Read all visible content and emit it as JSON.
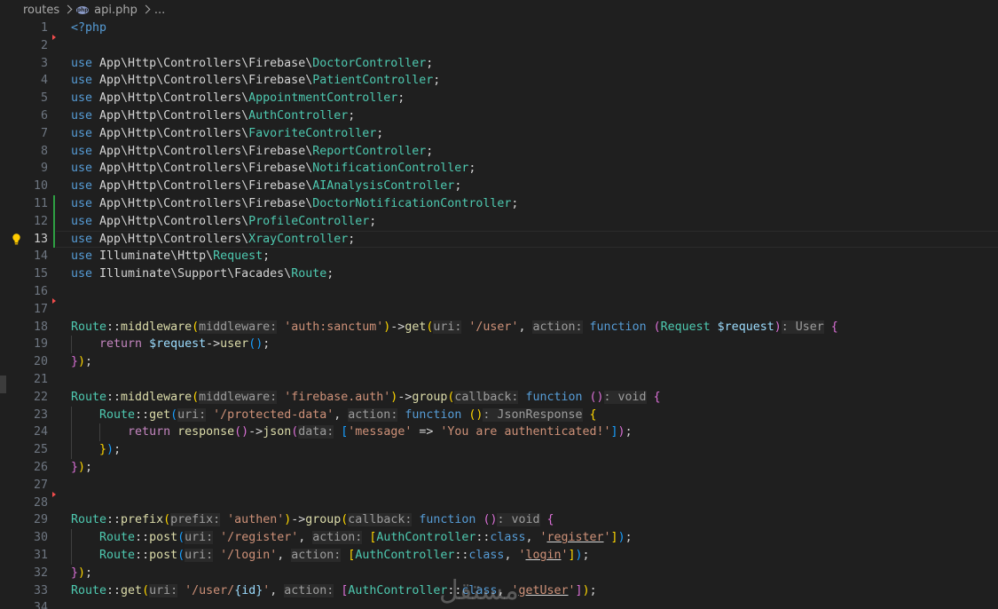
{
  "breadcrumb": {
    "folder": "routes",
    "file": "api.php",
    "file_icon": "php-file-icon",
    "more": "..."
  },
  "watermark": "مستقل",
  "current_line": 13,
  "lines": [
    {
      "n": "1",
      "tokens": [
        [
          "<?php",
          "tag"
        ]
      ]
    },
    {
      "n": "2",
      "tokens": [],
      "marker": "deleted"
    },
    {
      "n": "3",
      "tokens": [
        [
          "use",
          "kw"
        ],
        [
          " App\\Http\\Controllers\\Firebase\\",
          "plain"
        ],
        [
          "DoctorController",
          "cls"
        ],
        [
          ";",
          "plain"
        ]
      ]
    },
    {
      "n": "4",
      "tokens": [
        [
          "use",
          "kw"
        ],
        [
          " App\\Http\\Controllers\\Firebase\\",
          "plain"
        ],
        [
          "PatientController",
          "cls"
        ],
        [
          ";",
          "plain"
        ]
      ]
    },
    {
      "n": "5",
      "tokens": [
        [
          "use",
          "kw"
        ],
        [
          " App\\Http\\Controllers\\",
          "plain"
        ],
        [
          "AppointmentController",
          "cls"
        ],
        [
          ";",
          "plain"
        ]
      ]
    },
    {
      "n": "6",
      "tokens": [
        [
          "use",
          "kw"
        ],
        [
          " App\\Http\\Controllers\\",
          "plain"
        ],
        [
          "AuthController",
          "cls"
        ],
        [
          ";",
          "plain"
        ]
      ]
    },
    {
      "n": "7",
      "tokens": [
        [
          "use",
          "kw"
        ],
        [
          " App\\Http\\Controllers\\",
          "plain"
        ],
        [
          "FavoriteController",
          "cls"
        ],
        [
          ";",
          "plain"
        ]
      ]
    },
    {
      "n": "8",
      "tokens": [
        [
          "use",
          "kw"
        ],
        [
          " App\\Http\\Controllers\\Firebase\\",
          "plain"
        ],
        [
          "ReportController",
          "cls"
        ],
        [
          ";",
          "plain"
        ]
      ]
    },
    {
      "n": "9",
      "tokens": [
        [
          "use",
          "kw"
        ],
        [
          " App\\Http\\Controllers\\Firebase\\",
          "plain"
        ],
        [
          "NotificationController",
          "cls"
        ],
        [
          ";",
          "plain"
        ]
      ]
    },
    {
      "n": "10",
      "tokens": [
        [
          "use",
          "kw"
        ],
        [
          " App\\Http\\Controllers\\Firebase\\",
          "plain"
        ],
        [
          "AIAnalysisController",
          "cls"
        ],
        [
          ";",
          "plain"
        ]
      ]
    },
    {
      "n": "11",
      "tokens": [
        [
          "use",
          "kw"
        ],
        [
          " App\\Http\\Controllers\\Firebase\\",
          "plain"
        ],
        [
          "DoctorNotificationController",
          "cls"
        ],
        [
          ";",
          "plain"
        ]
      ],
      "marker": "added"
    },
    {
      "n": "12",
      "tokens": [
        [
          "use",
          "kw"
        ],
        [
          " App\\Http\\Controllers\\",
          "plain"
        ],
        [
          "ProfileController",
          "cls"
        ],
        [
          ";",
          "plain"
        ]
      ],
      "marker": "added"
    },
    {
      "n": "13",
      "tokens": [
        [
          "use",
          "kw"
        ],
        [
          " App\\Http\\Controllers\\",
          "plain"
        ],
        [
          "XrayController",
          "cls"
        ],
        [
          ";",
          "plain"
        ]
      ],
      "marker": "added",
      "lightbulb": true
    },
    {
      "n": "14",
      "tokens": [
        [
          "use",
          "kw"
        ],
        [
          " Illuminate\\Http\\",
          "plain"
        ],
        [
          "Request",
          "cls"
        ],
        [
          ";",
          "plain"
        ]
      ]
    },
    {
      "n": "15",
      "tokens": [
        [
          "use",
          "kw"
        ],
        [
          " Illuminate\\Support\\Facades\\",
          "plain"
        ],
        [
          "Route",
          "cls"
        ],
        [
          ";",
          "plain"
        ]
      ]
    },
    {
      "n": "16",
      "tokens": []
    },
    {
      "n": "17",
      "tokens": [],
      "marker": "deleted"
    },
    {
      "n": "18",
      "tokens": [
        [
          "Route",
          "cls"
        ],
        [
          "::",
          "plain"
        ],
        [
          "middleware",
          "fn"
        ],
        [
          "(",
          "p1"
        ],
        [
          "middleware:",
          "hint"
        ],
        [
          " ",
          "plain"
        ],
        [
          "'auth:sanctum'",
          "str"
        ],
        [
          ")",
          "p1"
        ],
        [
          "->",
          "plain"
        ],
        [
          "get",
          "fn"
        ],
        [
          "(",
          "p1"
        ],
        [
          "uri:",
          "hint"
        ],
        [
          " ",
          "plain"
        ],
        [
          "'/user'",
          "str"
        ],
        [
          ", ",
          "plain"
        ],
        [
          "action:",
          "hint"
        ],
        [
          " ",
          "plain"
        ],
        [
          "function",
          "kw"
        ],
        [
          " ",
          "plain"
        ],
        [
          "(",
          "p2"
        ],
        [
          "Request",
          "cls"
        ],
        [
          " ",
          "plain"
        ],
        [
          "$request",
          "var"
        ],
        [
          ")",
          "p2"
        ],
        [
          ": User",
          "hint"
        ],
        [
          " ",
          "plain"
        ],
        [
          "{",
          "p2"
        ]
      ]
    },
    {
      "n": "19",
      "tokens": [
        [
          "    ",
          "plain"
        ],
        [
          "return",
          "ctrl"
        ],
        [
          " ",
          "plain"
        ],
        [
          "$request",
          "var"
        ],
        [
          "->",
          "plain"
        ],
        [
          "user",
          "fn"
        ],
        [
          "()",
          "p3"
        ],
        [
          ";",
          "plain"
        ]
      ],
      "guides": [
        1
      ]
    },
    {
      "n": "20",
      "tokens": [
        [
          "}",
          "p2"
        ],
        [
          ")",
          "p1"
        ],
        [
          ";",
          "plain"
        ]
      ]
    },
    {
      "n": "21",
      "tokens": []
    },
    {
      "n": "22",
      "tokens": [
        [
          "Route",
          "cls"
        ],
        [
          "::",
          "plain"
        ],
        [
          "middleware",
          "fn"
        ],
        [
          "(",
          "p1"
        ],
        [
          "middleware:",
          "hint"
        ],
        [
          " ",
          "plain"
        ],
        [
          "'firebase.auth'",
          "str"
        ],
        [
          ")",
          "p1"
        ],
        [
          "->",
          "plain"
        ],
        [
          "group",
          "fn"
        ],
        [
          "(",
          "p1"
        ],
        [
          "callback:",
          "hint"
        ],
        [
          " ",
          "plain"
        ],
        [
          "function",
          "kw"
        ],
        [
          " ",
          "plain"
        ],
        [
          "()",
          "p2"
        ],
        [
          ": void",
          "hint"
        ],
        [
          " ",
          "plain"
        ],
        [
          "{",
          "p2"
        ]
      ]
    },
    {
      "n": "23",
      "tokens": [
        [
          "    ",
          "plain"
        ],
        [
          "Route",
          "cls"
        ],
        [
          "::",
          "plain"
        ],
        [
          "get",
          "fn"
        ],
        [
          "(",
          "p3"
        ],
        [
          "uri:",
          "hint"
        ],
        [
          " ",
          "plain"
        ],
        [
          "'/protected-data'",
          "str"
        ],
        [
          ", ",
          "plain"
        ],
        [
          "action:",
          "hint"
        ],
        [
          " ",
          "plain"
        ],
        [
          "function",
          "kw"
        ],
        [
          " ",
          "plain"
        ],
        [
          "()",
          "p1"
        ],
        [
          ": JsonResponse",
          "hint"
        ],
        [
          " ",
          "plain"
        ],
        [
          "{",
          "p1"
        ]
      ],
      "guides": [
        1
      ]
    },
    {
      "n": "24",
      "tokens": [
        [
          "        ",
          "plain"
        ],
        [
          "return",
          "ctrl"
        ],
        [
          " ",
          "plain"
        ],
        [
          "response",
          "fn"
        ],
        [
          "()",
          "p2"
        ],
        [
          "->",
          "plain"
        ],
        [
          "json",
          "fn"
        ],
        [
          "(",
          "p2"
        ],
        [
          "data:",
          "hint"
        ],
        [
          " ",
          "plain"
        ],
        [
          "[",
          "p3"
        ],
        [
          "'message'",
          "str"
        ],
        [
          " => ",
          "plain"
        ],
        [
          "'You are authenticated!'",
          "str"
        ],
        [
          "]",
          "p3"
        ],
        [
          ")",
          "p2"
        ],
        [
          ";",
          "plain"
        ]
      ],
      "guides": [
        1,
        2
      ]
    },
    {
      "n": "25",
      "tokens": [
        [
          "    ",
          "plain"
        ],
        [
          "}",
          "p1"
        ],
        [
          ")",
          "p3"
        ],
        [
          ";",
          "plain"
        ]
      ],
      "guides": [
        1
      ]
    },
    {
      "n": "26",
      "tokens": [
        [
          "}",
          "p2"
        ],
        [
          ")",
          "p1"
        ],
        [
          ";",
          "plain"
        ]
      ]
    },
    {
      "n": "27",
      "tokens": []
    },
    {
      "n": "28",
      "tokens": [],
      "marker": "deleted"
    },
    {
      "n": "29",
      "tokens": [
        [
          "Route",
          "cls"
        ],
        [
          "::",
          "plain"
        ],
        [
          "prefix",
          "fn"
        ],
        [
          "(",
          "p1"
        ],
        [
          "prefix:",
          "hint"
        ],
        [
          " ",
          "plain"
        ],
        [
          "'authen'",
          "str"
        ],
        [
          ")",
          "p1"
        ],
        [
          "->",
          "plain"
        ],
        [
          "group",
          "fn"
        ],
        [
          "(",
          "p1"
        ],
        [
          "callback:",
          "hint"
        ],
        [
          " ",
          "plain"
        ],
        [
          "function",
          "kw"
        ],
        [
          " ",
          "plain"
        ],
        [
          "()",
          "p2"
        ],
        [
          ": void",
          "hint"
        ],
        [
          " ",
          "plain"
        ],
        [
          "{",
          "p2"
        ]
      ]
    },
    {
      "n": "30",
      "tokens": [
        [
          "    ",
          "plain"
        ],
        [
          "Route",
          "cls"
        ],
        [
          "::",
          "plain"
        ],
        [
          "post",
          "fn"
        ],
        [
          "(",
          "p3"
        ],
        [
          "uri:",
          "hint"
        ],
        [
          " ",
          "plain"
        ],
        [
          "'/register'",
          "str"
        ],
        [
          ", ",
          "plain"
        ],
        [
          "action:",
          "hint"
        ],
        [
          " ",
          "plain"
        ],
        [
          "[",
          "p1"
        ],
        [
          "AuthController",
          "cls"
        ],
        [
          "::",
          "plain"
        ],
        [
          "class",
          "kw"
        ],
        [
          ", ",
          "plain"
        ],
        [
          "'",
          "str"
        ],
        [
          "register",
          "strul"
        ],
        [
          "'",
          "str"
        ],
        [
          "]",
          "p1"
        ],
        [
          ")",
          "p3"
        ],
        [
          ";",
          "plain"
        ]
      ],
      "guides": [
        1
      ]
    },
    {
      "n": "31",
      "tokens": [
        [
          "    ",
          "plain"
        ],
        [
          "Route",
          "cls"
        ],
        [
          "::",
          "plain"
        ],
        [
          "post",
          "fn"
        ],
        [
          "(",
          "p3"
        ],
        [
          "uri:",
          "hint"
        ],
        [
          " ",
          "plain"
        ],
        [
          "'/login'",
          "str"
        ],
        [
          ", ",
          "plain"
        ],
        [
          "action:",
          "hint"
        ],
        [
          " ",
          "plain"
        ],
        [
          "[",
          "p1"
        ],
        [
          "AuthController",
          "cls"
        ],
        [
          "::",
          "plain"
        ],
        [
          "class",
          "kw"
        ],
        [
          ", ",
          "plain"
        ],
        [
          "'",
          "str"
        ],
        [
          "login",
          "strul"
        ],
        [
          "'",
          "str"
        ],
        [
          "]",
          "p1"
        ],
        [
          ")",
          "p3"
        ],
        [
          ";",
          "plain"
        ]
      ],
      "guides": [
        1
      ]
    },
    {
      "n": "32",
      "tokens": [
        [
          "}",
          "p2"
        ],
        [
          ")",
          "p1"
        ],
        [
          ";",
          "plain"
        ]
      ]
    },
    {
      "n": "33",
      "tokens": [
        [
          "Route",
          "cls"
        ],
        [
          "::",
          "plain"
        ],
        [
          "get",
          "fn"
        ],
        [
          "(",
          "p1"
        ],
        [
          "uri:",
          "hint"
        ],
        [
          " ",
          "plain"
        ],
        [
          "'/user/",
          "str"
        ],
        [
          "{id}",
          "var"
        ],
        [
          "'",
          "str"
        ],
        [
          ", ",
          "plain"
        ],
        [
          "action:",
          "hint"
        ],
        [
          " ",
          "plain"
        ],
        [
          "[",
          "p2"
        ],
        [
          "AuthController",
          "cls"
        ],
        [
          "::",
          "plain"
        ],
        [
          "class",
          "kw"
        ],
        [
          ", ",
          "plain"
        ],
        [
          "'",
          "str"
        ],
        [
          "getUser",
          "strul"
        ],
        [
          "'",
          "str"
        ],
        [
          "]",
          "p2"
        ],
        [
          ")",
          "p1"
        ],
        [
          ";",
          "plain"
        ]
      ]
    },
    {
      "n": "34",
      "tokens": []
    }
  ]
}
